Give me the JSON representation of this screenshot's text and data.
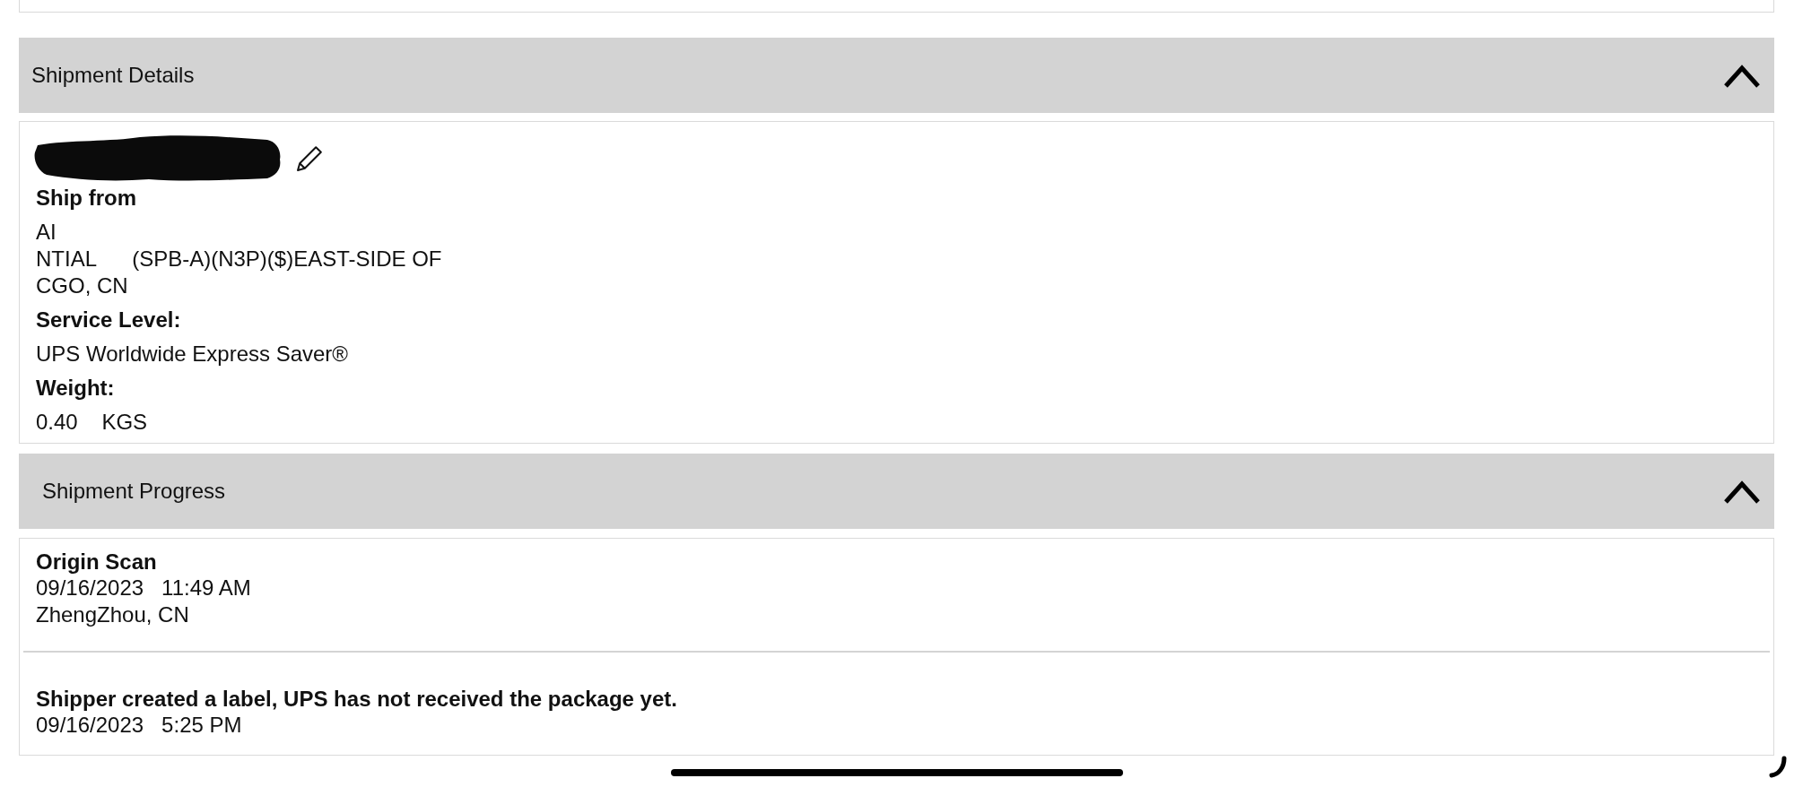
{
  "shipment_details": {
    "title": "Shipment Details",
    "expanded": true,
    "fields": [
      {
        "label": "Ship from",
        "lines": [
          "AI",
          "NTIAL      (SPB-A)(N3P)($)EAST-SIDE OF",
          "CGO, CN"
        ]
      },
      {
        "label": "Service Level:",
        "lines": [
          "UPS Worldwide Express Saver®"
        ]
      },
      {
        "label": "Weight:",
        "lines": [
          "0.40    KGS"
        ]
      }
    ]
  },
  "shipment_progress": {
    "title": "Shipment Progress",
    "expanded": true,
    "events": [
      {
        "status": "Origin Scan",
        "datetime": "09/16/2023   11:49 AM",
        "location": "ZhengZhou, CN"
      },
      {
        "status": "Shipper created a label, UPS has not received the package yet.",
        "datetime": "09/16/2023   5:25 PM"
      }
    ]
  }
}
